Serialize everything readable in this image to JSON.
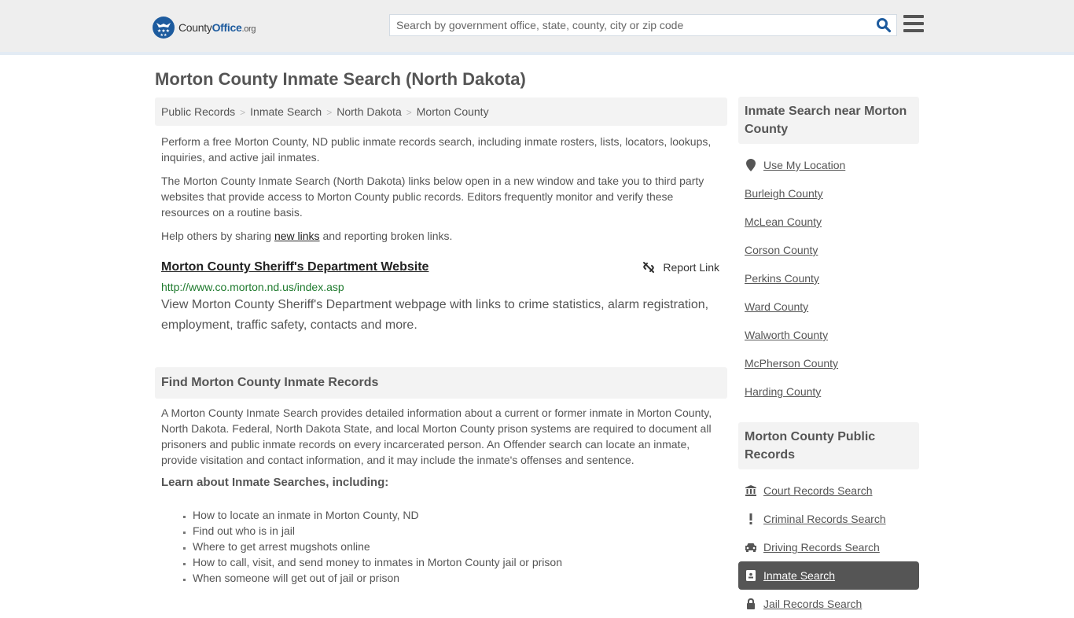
{
  "header": {
    "logo": {
      "brand_prefix": "County",
      "brand_main": "Office",
      "brand_suffix": ".org"
    },
    "search": {
      "placeholder": "Search by government office, state, county, city or zip code",
      "value": ""
    },
    "icons": {
      "search": "search-icon",
      "menu": "hamburger-menu-icon"
    }
  },
  "page": {
    "title": "Morton County Inmate Search (North Dakota)",
    "breadcrumb": [
      "Public Records",
      "Inmate Search",
      "North Dakota",
      "Morton County"
    ],
    "intro": [
      "Perform a free Morton County, ND public inmate records search, including inmate rosters, lists, locators, lookups, inquiries, and active jail inmates.",
      "The Morton County Inmate Search (North Dakota) links below open in a new window and take you to third party websites that provide access to Morton County public records. Editors frequently monitor and verify these resources on a routine basis."
    ],
    "help": {
      "before": "Help others by sharing ",
      "link": "new links",
      "after": " and reporting broken links."
    }
  },
  "links": [
    {
      "title": "Morton County Sheriff's Department Website",
      "url": "http://www.co.morton.nd.us/index.asp",
      "description": "View Morton County Sheriff's Department webpage with links to crime statistics, alarm registration, employment, traffic safety, contacts and more.",
      "report_label": "Report Link"
    }
  ],
  "find_section": {
    "heading": "Find Morton County Inmate Records",
    "body": "A Morton County Inmate Search provides detailed information about a current or former inmate in Morton County, North Dakota. Federal, North Dakota State, and local Morton County prison systems are required to document all prisoners and public inmate records on every incarcerated person. An Offender search can locate an inmate, provide visitation and contact information, and it may include the inmate's offenses and sentence.",
    "learn_heading": "Learn about Inmate Searches, including:",
    "bullets": [
      "How to locate an inmate in Morton County, ND",
      "Find out who is in jail",
      "Where to get arrest mugshots online",
      "How to call, visit, and send money to inmates in Morton County jail or prison",
      "When someone will get out of jail or prison"
    ]
  },
  "sidebar": {
    "nearby": {
      "heading": "Inmate Search near Morton County",
      "use_location": "Use My Location",
      "counties": [
        "Burleigh County",
        "McLean County",
        "Corson County",
        "Perkins County",
        "Ward County",
        "Walworth County",
        "McPherson County",
        "Harding County"
      ]
    },
    "public_records": {
      "heading": "Morton County Public Records",
      "items": [
        {
          "label": "Court Records Search",
          "icon": "courthouse-icon",
          "active": false
        },
        {
          "label": "Criminal Records Search",
          "icon": "exclamation-icon",
          "active": false
        },
        {
          "label": "Driving Records Search",
          "icon": "car-icon",
          "active": false
        },
        {
          "label": "Inmate Search",
          "icon": "id-badge-icon",
          "active": true
        },
        {
          "label": "Jail Records Search",
          "icon": "lock-icon",
          "active": false
        }
      ]
    }
  }
}
